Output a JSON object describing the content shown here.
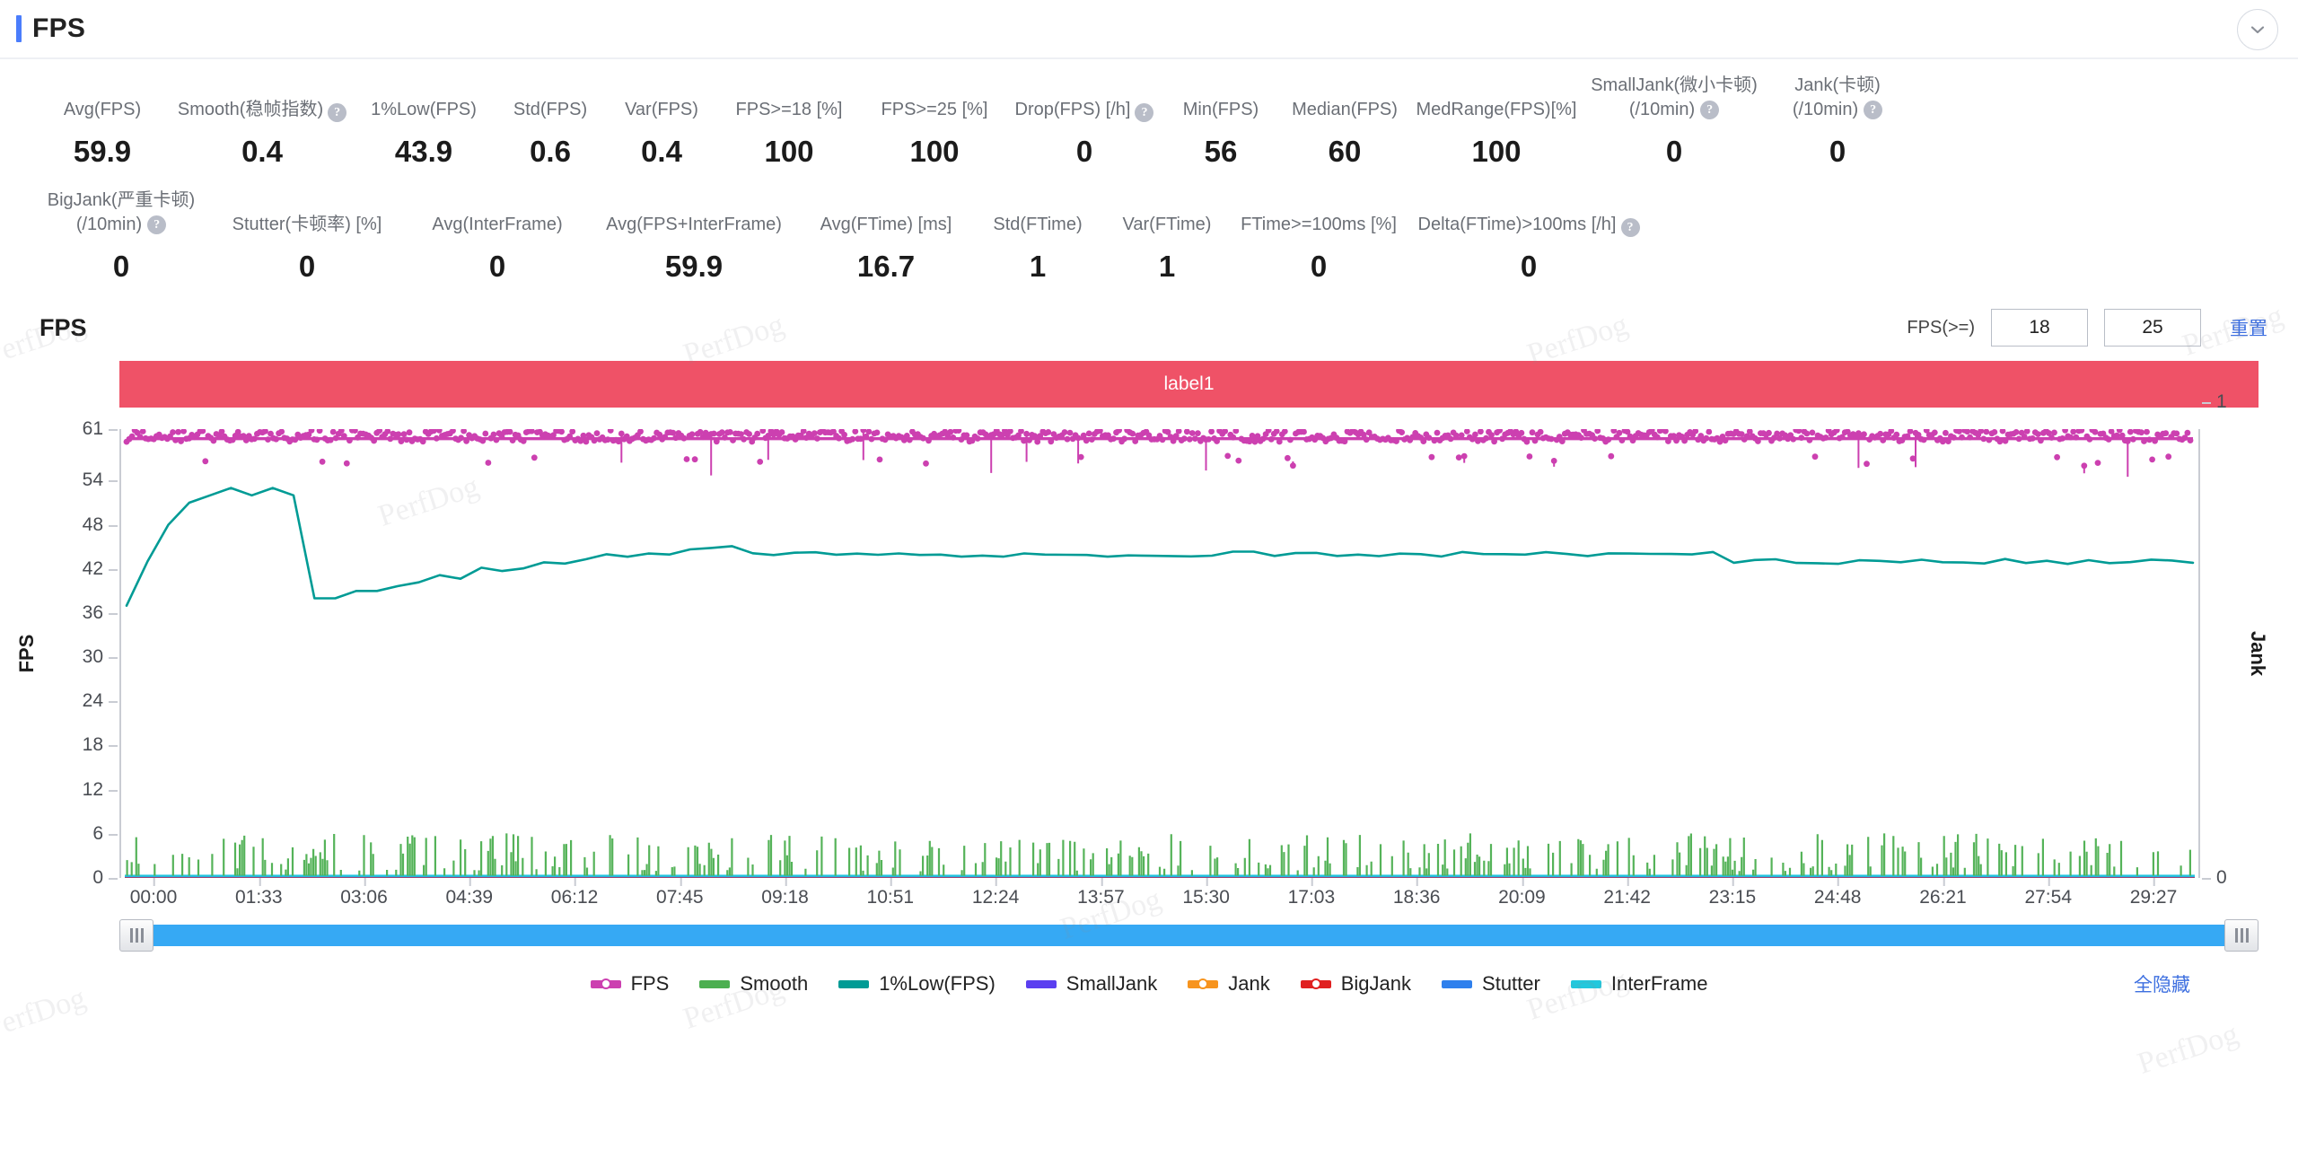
{
  "header": {
    "title": "FPS",
    "collapse_icon": "chevron-down-icon"
  },
  "metrics_rows": [
    [
      {
        "label": "Avg(FPS)",
        "value": "59.9",
        "help": false
      },
      {
        "label": "Smooth(稳帧指数)",
        "value": "0.4",
        "help": true
      },
      {
        "label": "1%Low(FPS)",
        "value": "43.9",
        "help": false
      },
      {
        "label": "Std(FPS)",
        "value": "0.6",
        "help": false
      },
      {
        "label": "Var(FPS)",
        "value": "0.4",
        "help": false
      },
      {
        "label": "FPS>=18 [%]",
        "value": "100",
        "help": false
      },
      {
        "label": "FPS>=25 [%]",
        "value": "100",
        "help": false
      },
      {
        "label": "Drop(FPS) [/h]",
        "value": "0",
        "help": true
      },
      {
        "label": "Min(FPS)",
        "value": "56",
        "help": false
      },
      {
        "label": "Median(FPS)",
        "value": "60",
        "help": false
      },
      {
        "label": "MedRange(FPS)[%]",
        "value": "100",
        "help": false
      },
      {
        "label": "SmallJank(微小卡顿)",
        "label2": "(/10min)",
        "value": "0",
        "help": true
      },
      {
        "label": "Jank(卡顿)",
        "label2": "(/10min)",
        "value": "0",
        "help": true
      }
    ],
    [
      {
        "label": "BigJank(严重卡顿)",
        "label2": "(/10min)",
        "value": "0",
        "help": true
      },
      {
        "label": "Stutter(卡顿率) [%]",
        "value": "0",
        "help": false
      },
      {
        "label": "Avg(InterFrame)",
        "value": "0",
        "help": false
      },
      {
        "label": "Avg(FPS+InterFrame)",
        "value": "59.9",
        "help": false
      },
      {
        "label": "Avg(FTime) [ms]",
        "value": "16.7",
        "help": false
      },
      {
        "label": "Std(FTime)",
        "value": "1",
        "help": false
      },
      {
        "label": "Var(FTime)",
        "value": "1",
        "help": false
      },
      {
        "label": "FTime>=100ms [%]",
        "value": "0",
        "help": false
      },
      {
        "label": "Delta(FTime)>100ms [/h]",
        "value": "0",
        "help": true
      }
    ]
  ],
  "chart_head": {
    "title": "FPS",
    "fps_ge_label": "FPS(>=)",
    "threshold_low": "18",
    "threshold_high": "25",
    "reset_label": "重置"
  },
  "label_band": {
    "text": "label1",
    "color": "#ef5267"
  },
  "range_bar": {
    "track_color": "#36a9f4",
    "left_handle": "grip-handle-left",
    "right_handle": "grip-handle-right"
  },
  "legend": {
    "items": [
      {
        "name": "FPS",
        "color": "#cc40b0",
        "marker": "dotted"
      },
      {
        "name": "Smooth",
        "color": "#4caf50",
        "marker": "line"
      },
      {
        "name": "1%Low(FPS)",
        "color": "#009b95",
        "marker": "line"
      },
      {
        "name": "SmallJank",
        "color": "#5b3ff0",
        "marker": "line"
      },
      {
        "name": "Jank",
        "color": "#f7941e",
        "marker": "dotted"
      },
      {
        "name": "BigJank",
        "color": "#e02020",
        "marker": "dotted"
      },
      {
        "name": "Stutter",
        "color": "#2f80ed",
        "marker": "line"
      },
      {
        "name": "InterFrame",
        "color": "#22c8dd",
        "marker": "line"
      }
    ],
    "hide_all_label": "全隐藏"
  },
  "watermark_text": "PerfDog",
  "chart_data": {
    "type": "line",
    "title": "FPS",
    "xlabel": "",
    "ylabel": "FPS",
    "y2label": "Jank",
    "ylim": [
      0,
      61
    ],
    "y2lim": [
      0,
      1
    ],
    "grid": false,
    "legend_position": "bottom",
    "y_ticks": [
      0,
      6,
      12,
      18,
      24,
      30,
      36,
      42,
      48,
      54,
      61
    ],
    "y2_ticks": [
      0,
      1
    ],
    "x_ticks": [
      "00:00",
      "01:33",
      "03:06",
      "04:39",
      "06:12",
      "07:45",
      "09:18",
      "10:51",
      "12:24",
      "13:57",
      "15:30",
      "17:03",
      "18:36",
      "20:09",
      "21:42",
      "23:15",
      "24:48",
      "26:21",
      "27:54",
      "29:27"
    ],
    "x_range": [
      "00:00",
      "30:00"
    ],
    "series": [
      {
        "name": "FPS",
        "color": "#cc40b0",
        "axis": "left",
        "style": "scatter-dense",
        "note": "Dense band of points near 59-61 FPS across the whole timeline with occasional dips to ~55-57",
        "mean": 59.9,
        "min": 56,
        "max": 61,
        "values": [
          60,
          60,
          59,
          61,
          60,
          60,
          60,
          58,
          60,
          61,
          60,
          59,
          60,
          60,
          57,
          60,
          61,
          60,
          60,
          59,
          60,
          60,
          60,
          60,
          58,
          60,
          61,
          60,
          59,
          60,
          60,
          60,
          60,
          56,
          60,
          60,
          61,
          60,
          60,
          59,
          60,
          60,
          60,
          58,
          60,
          60,
          60,
          61,
          60,
          60,
          59,
          60,
          57,
          60,
          60,
          60,
          61,
          60,
          60,
          60,
          59,
          60,
          60,
          60,
          58,
          60,
          61,
          60,
          60,
          60,
          59,
          60,
          60,
          60,
          60,
          57,
          60,
          61,
          60,
          60,
          59,
          60,
          60,
          60,
          58,
          60,
          60,
          61,
          60,
          60,
          60,
          59,
          60,
          60,
          56,
          60,
          61,
          60,
          60,
          60
        ]
      },
      {
        "name": "1%Low(FPS)",
        "color": "#009b95",
        "axis": "left",
        "style": "line",
        "note": "Rises from ~37 to ~53 in first 40s, drops sharply to ~38, then slowly climbs and settles around 43-44",
        "values": [
          37,
          43,
          48,
          51,
          52,
          53,
          52,
          53,
          52,
          38,
          38,
          39,
          39,
          40,
          40,
          41,
          41,
          42,
          42,
          42,
          43,
          43,
          43,
          44,
          44,
          44,
          44,
          45,
          45,
          45,
          44,
          44,
          44,
          44,
          44,
          44,
          44,
          44,
          44,
          44,
          44,
          44,
          44,
          44,
          44,
          44,
          44,
          44,
          44,
          44,
          44,
          44,
          44,
          44,
          44,
          44,
          44,
          44,
          44,
          44,
          44,
          44,
          44,
          44,
          44,
          44,
          44,
          44,
          44,
          44,
          44,
          44,
          44,
          44,
          44,
          44,
          44,
          43,
          43,
          43,
          43,
          43,
          43,
          43,
          43,
          43,
          43,
          43,
          43,
          43,
          43,
          43,
          43,
          43,
          43,
          43,
          43,
          43,
          43,
          43
        ]
      },
      {
        "name": "Smooth",
        "color": "#4caf50",
        "axis": "left",
        "style": "spikes",
        "note": "Small green spikes near baseline 0, occasional bursts up to ~6",
        "mean": 0.4
      },
      {
        "name": "Jank",
        "color": "#f7941e",
        "axis": "right",
        "style": "baseline",
        "note": "Flat at 0 across entire timeline",
        "values": [
          0
        ]
      },
      {
        "name": "SmallJank",
        "color": "#5b3ff0",
        "axis": "right",
        "style": "baseline",
        "values": [
          0
        ]
      },
      {
        "name": "BigJank",
        "color": "#e02020",
        "axis": "right",
        "style": "baseline",
        "values": [
          0
        ]
      },
      {
        "name": "Stutter",
        "color": "#2f80ed",
        "axis": "left",
        "style": "baseline",
        "values": [
          0
        ]
      },
      {
        "name": "InterFrame",
        "color": "#22c8dd",
        "axis": "left",
        "style": "baseline",
        "values": [
          0
        ]
      }
    ]
  }
}
